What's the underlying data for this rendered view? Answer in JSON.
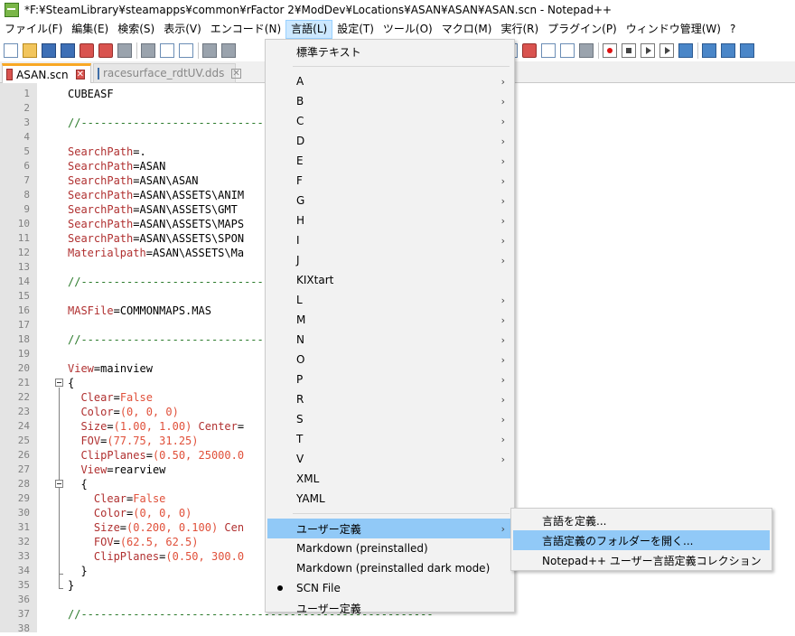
{
  "window": {
    "title": "*F:¥SteamLibrary¥steamapps¥common¥rFactor 2¥ModDev¥Locations¥ASAN¥ASAN¥ASAN.scn - Notepad++"
  },
  "menubar": [
    "ファイル(F)",
    "編集(E)",
    "検索(S)",
    "表示(V)",
    "エンコード(N)",
    "言語(L)",
    "設定(T)",
    "ツール(O)",
    "マクロ(M)",
    "実行(R)",
    "プラグイン(P)",
    "ウィンドウ管理(W)",
    "?"
  ],
  "tabs": [
    {
      "label": "ASAN.scn",
      "active": true,
      "close": "✕"
    },
    {
      "label": "racesurface_rdtUV.dds",
      "active": false,
      "close": "✕"
    }
  ],
  "editor": {
    "lines": [
      {
        "n": "1",
        "html": "CUBEASF"
      },
      {
        "n": "2",
        "html": ""
      },
      {
        "n": "3",
        "html": "//------------------------------------------------------"
      },
      {
        "n": "4",
        "html": ""
      },
      {
        "n": "5",
        "html": "SearchPath=."
      },
      {
        "n": "6",
        "html": "SearchPath=ASAN"
      },
      {
        "n": "7",
        "html": "SearchPath=ASAN\\ASAN"
      },
      {
        "n": "8",
        "html": "SearchPath=ASAN\\ASSETS\\ANIM"
      },
      {
        "n": "9",
        "html": "SearchPath=ASAN\\ASSETS\\GMT"
      },
      {
        "n": "10",
        "html": "SearchPath=ASAN\\ASSETS\\MAPS"
      },
      {
        "n": "11",
        "html": "SearchPath=ASAN\\ASSETS\\SPON"
      },
      {
        "n": "12",
        "html": "Materialpath=ASAN\\ASSETS\\Ma"
      },
      {
        "n": "13",
        "html": ""
      },
      {
        "n": "14",
        "html": "//------------------------------------------------------"
      },
      {
        "n": "15",
        "html": ""
      },
      {
        "n": "16",
        "html": "MASFile=COMMONMAPS.MAS"
      },
      {
        "n": "17",
        "html": ""
      },
      {
        "n": "18",
        "html": "//------------------------------------------------------"
      },
      {
        "n": "19",
        "html": ""
      },
      {
        "n": "20",
        "html": "View=mainview"
      },
      {
        "n": "21",
        "html": "{"
      },
      {
        "n": "22",
        "html": "  Clear=False"
      },
      {
        "n": "23",
        "html": "  Color=(0, 0, 0)"
      },
      {
        "n": "24",
        "html": "  Size=(1.00, 1.00) Center="
      },
      {
        "n": "25",
        "html": "  FOV=(77.75, 31.25)"
      },
      {
        "n": "26",
        "html": "  ClipPlanes=(0.50, 25000.0"
      },
      {
        "n": "27",
        "html": "  View=rearview"
      },
      {
        "n": "28",
        "html": "  {"
      },
      {
        "n": "29",
        "html": "    Clear=False"
      },
      {
        "n": "30",
        "html": "    Color=(0, 0, 0)"
      },
      {
        "n": "31",
        "html": "    Size=(0.200, 0.100) Cen"
      },
      {
        "n": "32",
        "html": "    FOV=(62.5, 62.5)"
      },
      {
        "n": "33",
        "html": "    ClipPlanes=(0.50, 300.0"
      },
      {
        "n": "34",
        "html": "  }"
      },
      {
        "n": "35",
        "html": "}"
      },
      {
        "n": "36",
        "html": ""
      },
      {
        "n": "37",
        "html": "//------------------------------------------------------"
      },
      {
        "n": "38",
        "html": ""
      }
    ]
  },
  "language_menu": {
    "items": [
      {
        "label": "標準テキスト",
        "arrow": false
      },
      {
        "sep": true
      },
      {
        "label": "A",
        "arrow": true
      },
      {
        "label": "B",
        "arrow": true
      },
      {
        "label": "C",
        "arrow": true
      },
      {
        "label": "D",
        "arrow": true
      },
      {
        "label": "E",
        "arrow": true
      },
      {
        "label": "F",
        "arrow": true
      },
      {
        "label": "G",
        "arrow": true
      },
      {
        "label": "H",
        "arrow": true
      },
      {
        "label": "I",
        "arrow": true
      },
      {
        "label": "J",
        "arrow": true
      },
      {
        "label": "KIXtart",
        "arrow": false
      },
      {
        "label": "L",
        "arrow": true
      },
      {
        "label": "M",
        "arrow": true
      },
      {
        "label": "N",
        "arrow": true
      },
      {
        "label": "O",
        "arrow": true
      },
      {
        "label": "P",
        "arrow": true
      },
      {
        "label": "R",
        "arrow": true
      },
      {
        "label": "S",
        "arrow": true
      },
      {
        "label": "T",
        "arrow": true
      },
      {
        "label": "V",
        "arrow": true
      },
      {
        "label": "XML",
        "arrow": false
      },
      {
        "label": "YAML",
        "arrow": false
      },
      {
        "sep": true
      },
      {
        "label": "ユーザー定義",
        "arrow": true,
        "highlight": true
      },
      {
        "label": "Markdown (preinstalled)",
        "arrow": false
      },
      {
        "label": "Markdown (preinstalled dark mode)",
        "arrow": false
      },
      {
        "label": "SCN File",
        "arrow": false,
        "checked": true
      },
      {
        "label": "ユーザー定義",
        "arrow": false
      }
    ],
    "arrow_glyph": "›"
  },
  "user_defined_submenu": {
    "items": [
      {
        "label": "言語を定義...",
        "highlight": false
      },
      {
        "label": "言語定義のフォルダーを開く...",
        "highlight": true
      },
      {
        "label": "Notepad++ ユーザー言語定義コレクション",
        "highlight": false
      }
    ]
  },
  "colors": {
    "keyword": "#b03030",
    "value": "#e0503a",
    "comment": "#2a7a2a",
    "menu_highlight": "#91c9f7"
  }
}
